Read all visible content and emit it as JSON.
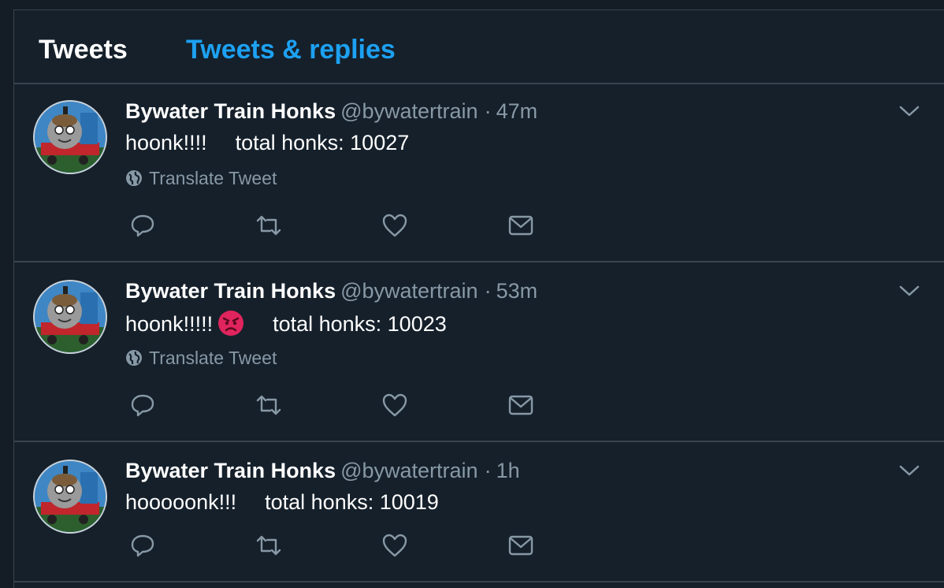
{
  "tabs": {
    "tweets_label": "Tweets",
    "replies_label": "Tweets & replies"
  },
  "tweets": [
    {
      "name": "Bywater Train Honks",
      "handle": "@bywatertrain",
      "separator": "·",
      "time": "47m",
      "text": "hoonk!!!!",
      "count_text": "total honks: 10027",
      "translate": "Translate Tweet"
    },
    {
      "name": "Bywater Train Honks",
      "handle": "@bywatertrain",
      "separator": "·",
      "time": "53m",
      "text": "hoonk!!!!!",
      "emoji": "angry-face",
      "count_text": "total honks: 10023",
      "translate": "Translate Tweet"
    },
    {
      "name": "Bywater Train Honks",
      "handle": "@bywatertrain",
      "separator": "·",
      "time": "1h",
      "text": "hooooonk!!!",
      "count_text": "total honks: 10019"
    }
  ],
  "colors": {
    "background": "#15202b",
    "accent": "#1da1f2",
    "muted": "#8899a6",
    "border": "#38444d"
  },
  "icons": [
    "reply-icon",
    "retweet-icon",
    "like-icon",
    "direct-message-icon",
    "globe-icon",
    "chevron-down-icon"
  ]
}
